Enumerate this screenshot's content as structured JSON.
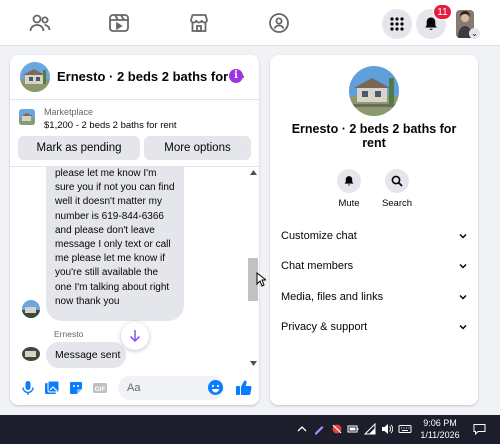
{
  "nav": {
    "notification_count": "11",
    "items": [
      "friends-icon",
      "watch-icon",
      "marketplace-icon",
      "groups-icon",
      "menu-grid-icon",
      "bell-icon",
      "profile-avatar"
    ]
  },
  "chat": {
    "title": "Ernesto · 2 beds 2 baths for ⋯",
    "marketplace_label": "Marketplace",
    "listing": "$1,200 - 2 beds 2 baths for rent",
    "mark_pending": "Mark as pending",
    "more_options": "More options",
    "message_text": "please let me know I'm sure you if not you can find well it doesn't matter my number is 619-844-6366 and please don't leave message I only text or call me please let me know if you're still available the one I'm talking about right now thank you",
    "sender": "Ernesto",
    "sent_message": "Message sent",
    "input_placeholder": "Aa"
  },
  "side": {
    "name": "Ernesto · 2 beds 2 baths for rent",
    "mute": "Mute",
    "search": "Search",
    "rows": [
      "Customize chat",
      "Chat members",
      "Media, files and links",
      "Privacy & support"
    ]
  },
  "taskbar": {
    "time": "9:06 PM",
    "date": "1/11/2026"
  },
  "colors": {
    "accent": "#0a7cff",
    "badge": "#e41e3f",
    "info": "#a033e6",
    "taskbar": "#1c1f2b"
  }
}
